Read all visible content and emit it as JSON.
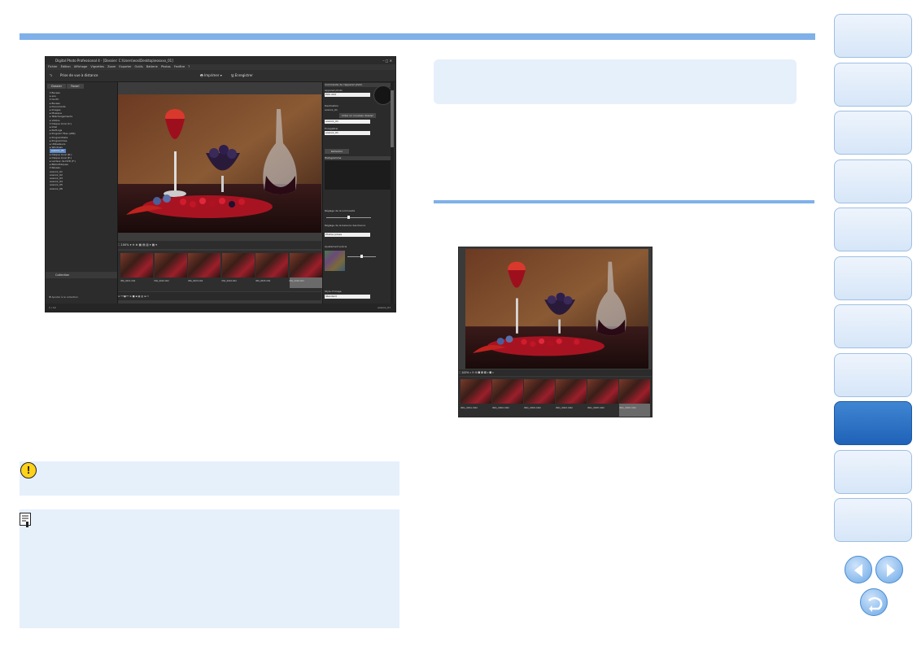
{
  "app": {
    "title": "Digital Photo Professional 4 - [Dossier: C:\\Users\\eos\\Desktop\\eosxxx_01]",
    "window_controls": "–  □  ✕",
    "menu": [
      "Fichier",
      "Édition",
      "Affichage",
      "Vignettes",
      "Zoom",
      "Exporter",
      "Outils",
      "Batterie",
      "Photos",
      "Fenêtre",
      "?"
    ],
    "toolbar": {
      "back_icon": "back-arrow-icon",
      "back_label": "Prise de vue à distance",
      "print_label": "Imprimer",
      "save_label": "Enregistrer"
    },
    "left_tabs": [
      "Dossier",
      "Favori"
    ],
    "tree": [
      "▾ Bureau",
      "  ▸ eos",
      "  ▾ Ce PC",
      "     ▸ Bureau",
      "     ▸ Documents",
      "     ▸ Images",
      "     ▸ Musique",
      "     ▸ Téléchargements",
      "     ▸ Vidéos",
      "  ▾ Disque local (C:)",
      "     ▸ Intel",
      "     ▸ PerfLogs",
      "     ▸ Program Files (x86)",
      "     ▸ ProgramData",
      "     ▸ Programmes",
      "     ▸ Utilisateurs",
      "     ▸ Windows",
      "     eosxxx_01",
      "  ▸ Disque local (D:)",
      "  ▸ Disque local (E:)",
      "  ▸ Lecteur de DVD (F:)",
      "  ▸ Bibliothèques",
      "  ▾ Réseau",
      "     eosxxx_01",
      "     eosxxx_02",
      "     eosxxx_03",
      "     eosxxx_04",
      "     eosxxx_05",
      "     eosxxx_06"
    ],
    "tree_selected_index": 17,
    "collection_label": "Collection",
    "add_collection": "Ajouter à la collection",
    "zoom": "100%",
    "thumbs": [
      "IMG_0001.CR2",
      "IMG_0002.CR2",
      "IMG_0003.CR2",
      "IMG_0004.CR2",
      "IMG_0005.CR2",
      "IMG_0006.CR2"
    ],
    "status_left": "1 / 12",
    "status_right": "eosxxx_01",
    "right_panel": {
      "header": "Commande de l'appareil photo",
      "camera_label": "Appareil photo",
      "camera_value": "EOS XXX",
      "dest_label": "Destination",
      "dest_value": "eosxxx_01",
      "create_folder": "Créer un nouveau dossier",
      "name_label": "Enregistrer",
      "name_value": "eosxxx_01",
      "reload": "Rafraîchir",
      "hist_header": "Histogramme",
      "bright_label": "Réglage de la luminosité",
      "wb_label": "Réglage de la balance des blancs",
      "wb_value": "Photos prises",
      "tone_label": "Ajustement précis",
      "style_label": "Style d'image",
      "style_value": "Standard"
    }
  },
  "shot2": {
    "zoom": "100%",
    "thumbs": [
      "IMG_0001.CR2",
      "IMG_0002.CR2",
      "IMG_0003.CR2",
      "IMG_0004.CR2",
      "IMG_0005.CR2",
      "IMG_0006.CR2"
    ]
  },
  "icons": {
    "caution": "caution-icon",
    "memo": "memo-icon",
    "prev": "prev-page-icon",
    "next": "next-page-icon",
    "return": "return-icon"
  },
  "colors": {
    "accent_blue": "#7fb1e8",
    "box_bg": "#e6f0fb",
    "nav_active": "#1f62b8"
  },
  "nav": {
    "active_index": 8,
    "count": 11
  }
}
